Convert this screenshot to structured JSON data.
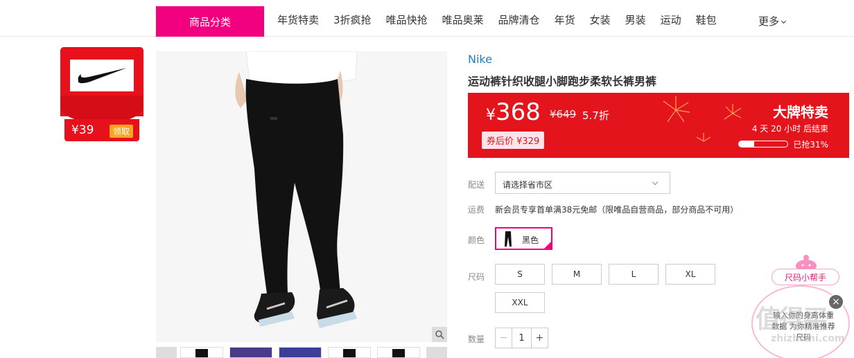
{
  "nav": {
    "category_button": "商品分类",
    "links": [
      "年货特卖",
      "3折疯抢",
      "唯品快抢",
      "唯品奥莱",
      "品牌清仓",
      "年货",
      "女装",
      "男装",
      "运动",
      "鞋包"
    ],
    "more": "更多"
  },
  "coupon": {
    "amount": "¥39",
    "claim": "领取"
  },
  "product": {
    "brand": "Nike",
    "title": "运动裤针织收腿小脚跑步柔软长裤男裤"
  },
  "price": {
    "current_symbol": "¥",
    "current": "368",
    "original": "¥649",
    "discount": "5.7折",
    "after_coupon": "券后价 ¥329",
    "promo_title": "大牌特卖",
    "countdown": "4 天 20 小时 后结束",
    "sold_label": "已抢31%",
    "sold_fraction": 0.31
  },
  "delivery": {
    "label": "配送",
    "select_value": "请选择省市区"
  },
  "shipping": {
    "label": "运费",
    "text": "新会员专享首单满38元免邮（限唯品自营商品，部分商品不可用）"
  },
  "color": {
    "label": "颜色",
    "option": "黑色"
  },
  "size": {
    "label": "尺码",
    "options": [
      "S",
      "M",
      "L",
      "XL",
      "XXL"
    ]
  },
  "quantity": {
    "label": "数量",
    "value": "1",
    "minus": "−",
    "plus": "+"
  },
  "helper": {
    "pill": "尺码小帮手",
    "text": "输入你的身高体重数据 为你精准推荐尺码",
    "close": "×"
  },
  "watermark": {
    "big": "值得买",
    "small": "zhizhizhi.com"
  },
  "colors": {
    "accent": "#f10180",
    "promo_red": "#e4141c",
    "brand_blue": "#1a7fcb"
  }
}
